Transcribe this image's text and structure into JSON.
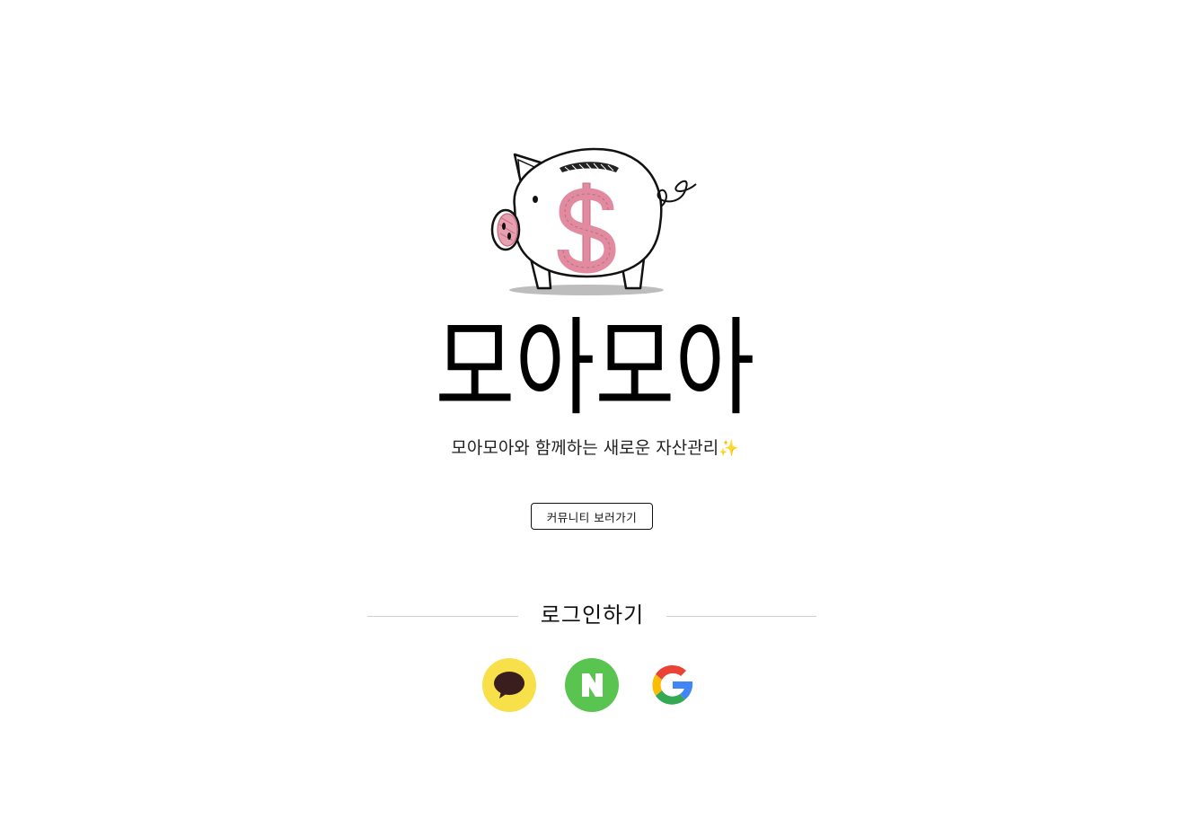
{
  "hero": {
    "logo_icon": "piggy-bank-dollar-icon",
    "title": "모아모아",
    "tagline": "모아모아와 함께하는 새로운 자산관리",
    "tagline_emoji": "✨"
  },
  "community_button_label": "커뮤니티 보러가기",
  "login": {
    "heading": "로그인하기",
    "providers": [
      {
        "name": "kakao",
        "icon": "kakao-chat-bubble-icon",
        "color": "#f7e04a"
      },
      {
        "name": "naver",
        "icon": "naver-n-icon",
        "color": "#5ac451"
      },
      {
        "name": "google",
        "icon": "google-g-icon",
        "color": "#ffffff"
      }
    ]
  },
  "colors": {
    "background": "#ffffff",
    "text": "#111111",
    "piggy_accent": "#e28aa0",
    "divider": "#d0d0d0"
  }
}
